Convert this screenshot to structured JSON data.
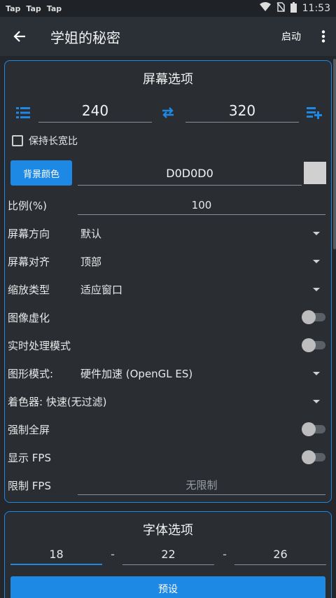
{
  "status_bar": {
    "notifications": [
      "Tap",
      "Tap",
      "Tap"
    ],
    "time": "11:53"
  },
  "app_bar": {
    "title": "学姐的秘密",
    "action_label": "启动"
  },
  "screen_options": {
    "title": "屏幕选项",
    "width": "240",
    "height": "320",
    "keep_aspect_label": "保持长宽比",
    "keep_aspect_checked": false,
    "bg_color_button": "背景颜色",
    "bg_color_value": "D0D0D0",
    "bg_color_swatch": "#d0d0d0",
    "scale_label": "比例(%)",
    "scale_value": "100",
    "orientation_label": "屏幕方向",
    "orientation_value": "默认",
    "align_label": "屏幕对齐",
    "align_value": "顶部",
    "zoom_label": "缩放类型",
    "zoom_value": "适应窗口",
    "virtualize_label": "图像虚化",
    "virtualize_on": false,
    "realtime_label": "实时处理模式",
    "realtime_on": false,
    "graphics_label": "图形模式:",
    "graphics_value": "硬件加速 (OpenGL ES)",
    "shader_label": "着色器: 快速(无过滤)",
    "fullscreen_label": "强制全屏",
    "fullscreen_on": false,
    "show_fps_label": "显示 FPS",
    "show_fps_on": false,
    "limit_fps_label": "限制 FPS",
    "limit_fps_value": "无限制"
  },
  "font_options": {
    "title": "字体选项",
    "size_min": "18",
    "size_mid": "22",
    "size_max": "26",
    "dash": "-",
    "preset_button": "预设"
  },
  "colors": {
    "accent": "#1e88e5",
    "background": "#23272c",
    "card": "#2a2e33"
  }
}
